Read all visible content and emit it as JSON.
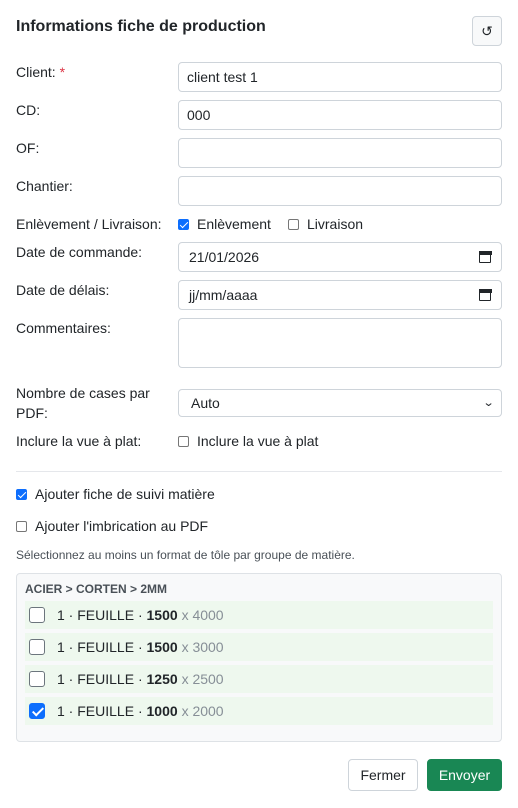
{
  "modal": {
    "title": "Informations fiche de production",
    "reset_icon": "↺"
  },
  "form": {
    "client": {
      "label": "Client:",
      "required_mark": "*",
      "value": "client test 1"
    },
    "cd": {
      "label": "CD:",
      "value": "000"
    },
    "of": {
      "label": "OF:",
      "value": ""
    },
    "chantier": {
      "label": "Chantier:",
      "value": ""
    },
    "enlevement_livraison": {
      "label": "Enlèvement / Livraison:",
      "options": [
        {
          "label": "Enlèvement",
          "checked": true
        },
        {
          "label": "Livraison",
          "checked": false
        }
      ]
    },
    "date_commande": {
      "label": "Date de commande:",
      "value": "21/01/2026"
    },
    "date_delais": {
      "label": "Date de délais:",
      "value": "jj/mm/aaaa"
    },
    "commentaires": {
      "label": "Commentaires:",
      "value": ""
    },
    "cases_par_pdf": {
      "label_line1": "Nombre de cases par",
      "label_line2": "PDF:",
      "value": "Auto"
    },
    "vue_a_plat": {
      "label": "Inclure la vue à plat:",
      "checkbox_label": "Inclure la vue à plat",
      "checked": false
    }
  },
  "options": {
    "suivi_matiere": {
      "label": "Ajouter fiche de suivi matière",
      "checked": true
    },
    "imbrication": {
      "label": "Ajouter l'imbrication au PDF",
      "checked": false
    },
    "hint": "Sélectionnez au moins un format de tôle par groupe de matière."
  },
  "material_group": {
    "title": "ACIER > CORTEN > 2MM",
    "sheets": [
      {
        "qty": "1",
        "type": "FEUILLE",
        "width": "1500",
        "height": "x 4000",
        "checked": false
      },
      {
        "qty": "1",
        "type": "FEUILLE",
        "width": "1500",
        "height": "x 3000",
        "checked": false
      },
      {
        "qty": "1",
        "type": "FEUILLE",
        "width": "1250",
        "height": "x 2500",
        "checked": false
      },
      {
        "qty": "1",
        "type": "FEUILLE",
        "width": "1000",
        "height": "x 2000",
        "checked": true
      }
    ]
  },
  "footer": {
    "close_label": "Fermer",
    "send_label": "Envoyer"
  },
  "colors": {
    "primary": "#0d6efd",
    "success": "#198754",
    "required": "#dc3545",
    "sheet_bg": "#eef8ee"
  },
  "icons": {
    "reset": "reset-icon",
    "calendar": "calendar-icon",
    "chevron": "chevron-down-icon"
  }
}
